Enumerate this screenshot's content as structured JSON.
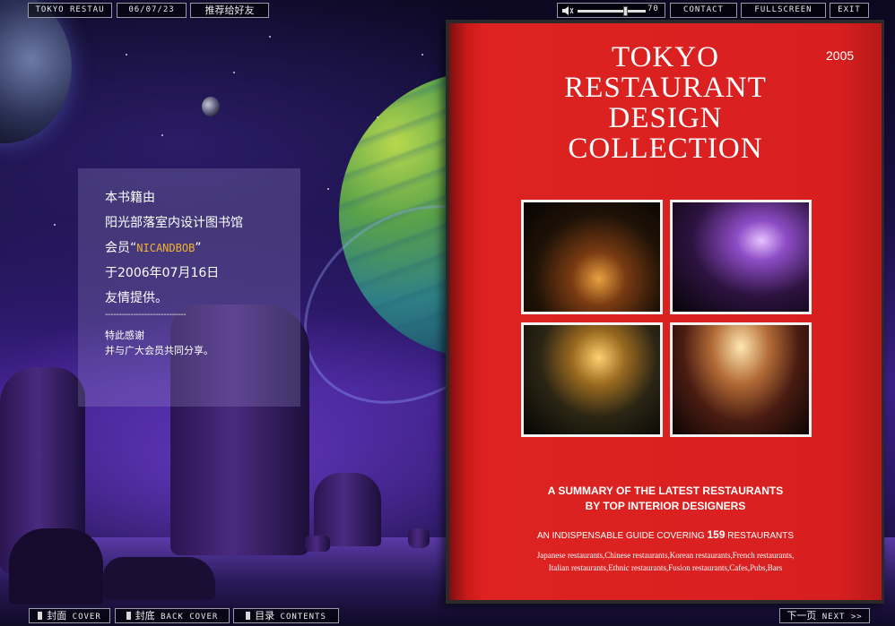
{
  "topbar": {
    "title_label": "TOKYO RESTAU",
    "date_label": "06/07/23",
    "recommend_label": "推荐给好友",
    "volume_value": "70",
    "volume_level": 0.7,
    "contact_label": "CONTACT",
    "fullscreen_label": "FULLSCREEN",
    "exit_label": "EXIT"
  },
  "info_panel": {
    "line1": "本书籍由",
    "line2": "阳光部落室内设计图书馆",
    "line3_prefix": "会员“",
    "member_name": "NICANDBOB",
    "line3_suffix": "”",
    "line4": "于2006年07月16日",
    "line5": "友情提供。",
    "divider": "-----------------------------",
    "thanks1": "特此感谢",
    "thanks2": "并与广大会员共同分享。"
  },
  "cover": {
    "year": "2005",
    "title_lines": [
      "TOKYO",
      "RESTAURANT",
      "DESIGN",
      "COLLECTION"
    ],
    "subtitle_line1": "A SUMMARY OF THE LATEST RESTAURANTS",
    "subtitle_line2": "BY TOP INTERIOR DESIGNERS",
    "guide_prefix": "AN INDISPENSABLE GUIDE COVERING ",
    "guide_count": "159",
    "guide_suffix": " RESTAURANTS",
    "list_line1": "Japanese restaurants,Chinese restaurants,Korean restaurants,French restaurants,",
    "list_line2": "Italian restaurants,Ethnic restaurants,Fusion restaurants,Cafes,Pubs,Bars"
  },
  "bottombar": {
    "cover_cn": "封面",
    "cover_en": " COVER",
    "back_cn": "封底",
    "back_en": " BACK COVER",
    "contents_cn": "目录",
    "contents_en": " CONTENTS",
    "next_cn": "下一页",
    "next_en": " NEXT >>"
  },
  "icons": {
    "speaker": "speaker-icon",
    "nav_square": "square-icon"
  },
  "colors": {
    "cover_red": "#d81f1f",
    "member_name": "#f2b233",
    "button_border": "#9a9aa8"
  }
}
